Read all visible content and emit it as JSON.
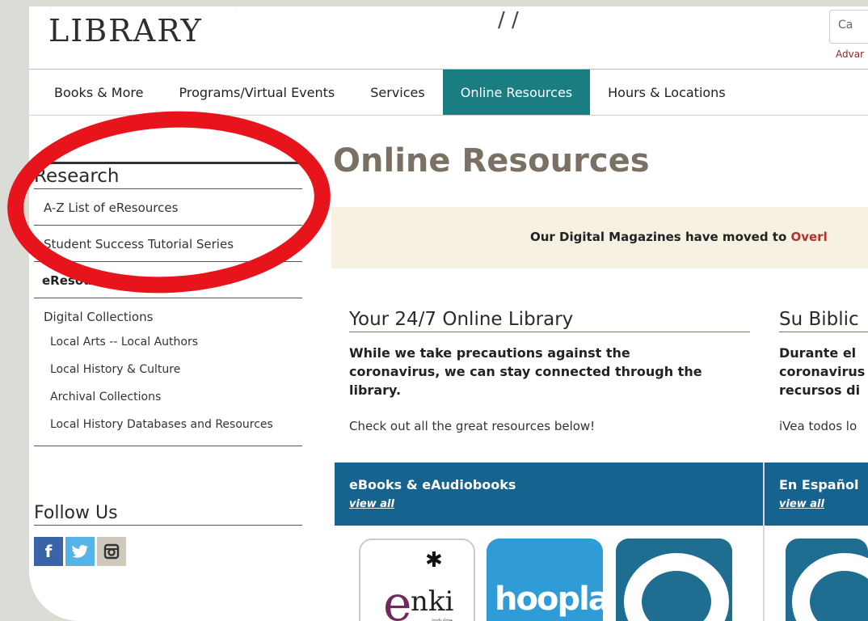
{
  "header": {
    "logo_text": "LIBRARY",
    "tagline_fragment": "/ /",
    "search_placeholder_fragment": "Ca",
    "advanced_link_fragment": "Advar"
  },
  "nav": {
    "items": [
      {
        "label": "Books & More"
      },
      {
        "label": "Programs/Virtual Events"
      },
      {
        "label": "Services"
      },
      {
        "label": "Online Resources"
      },
      {
        "label": "Hours & Locations"
      }
    ],
    "active": "Online Resources",
    "active_color": "#1a7d82"
  },
  "sidebar": {
    "heading": "Research",
    "links": [
      "A-Z List of eResources",
      "Student Success Tutorial Series"
    ],
    "bold_item": "eResources",
    "sub_heading": "Digital Collections",
    "sub_links": [
      "Local Arts -- Local Authors",
      "Local History & Culture",
      "Archival Collections",
      "Local History Databases and Resources"
    ],
    "follow_heading": "Follow Us",
    "social": [
      "facebook-icon",
      "twitter-icon",
      "instagram-icon"
    ]
  },
  "main": {
    "title": "Online Resources",
    "banner_text": "Our Digital Magazines have moved to ",
    "banner_link": "Overl",
    "left_column": {
      "title": "Your 24/7 Online Library",
      "bold_lines": [
        "While we take precautions against the",
        "coronavirus, we can stay connected through the",
        "library."
      ],
      "plain": "Check out all the great resources below!"
    },
    "right_column": {
      "title": "Su Biblic",
      "bold_lines": [
        "Durante el",
        "coronavirus",
        "recursos di"
      ],
      "plain": "iVea todos lo"
    },
    "panels": [
      {
        "title": "eBooks & eAudiobooks",
        "link": "view all"
      },
      {
        "title": "En Español",
        "link": "view all"
      }
    ],
    "tiles": {
      "enki_letter": "e",
      "enki_word": "nki",
      "enki_tag": "indulge",
      "hoopla_word": "hoopla"
    }
  },
  "annotation": {
    "circle_color": "#e8141b"
  }
}
